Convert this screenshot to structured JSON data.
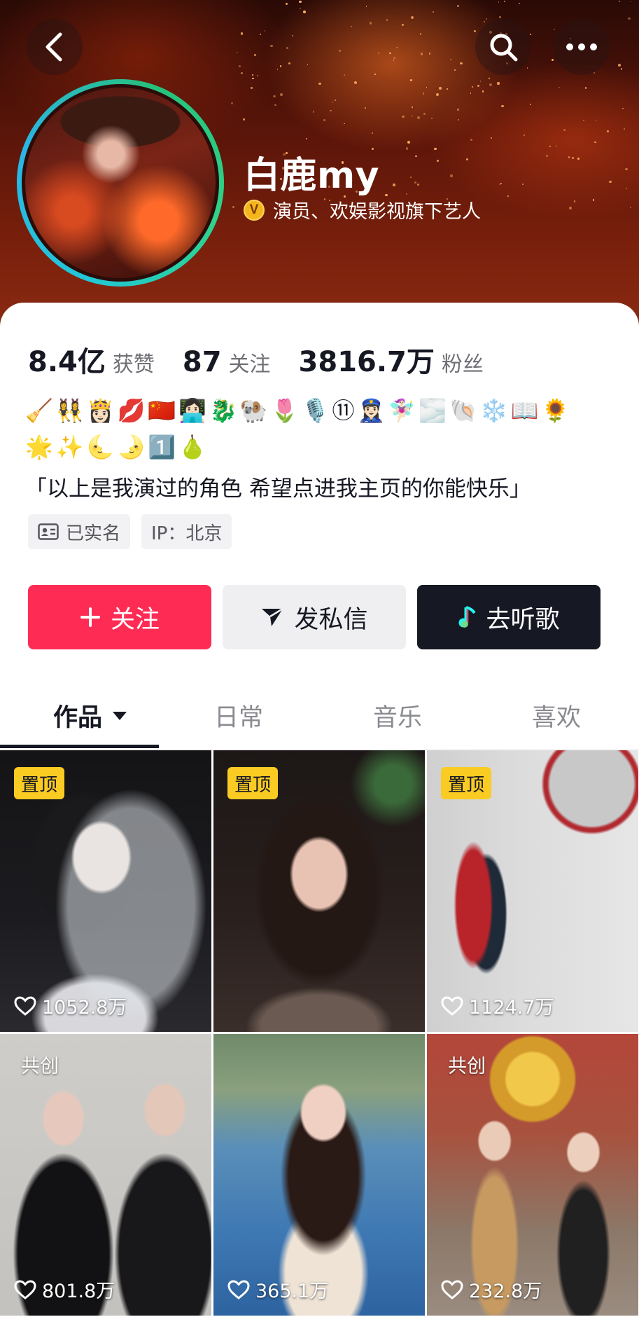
{
  "header": {
    "display_name": "白鹿my",
    "verify_badge": "V",
    "verify_text": "演员、欢娱影视旗下艺人",
    "back_icon": "chevron-left-icon",
    "search_icon": "search-icon",
    "more_icon": "more-dots-icon"
  },
  "stats": [
    {
      "value": "8.4亿",
      "label": "获赞"
    },
    {
      "value": "87",
      "label": "关注"
    },
    {
      "value": "3816.7万",
      "label": "粉丝"
    }
  ],
  "bio": {
    "emoji_line_1": "🧹👯‍♀️👸🏻💋🇨🇳👩🏻‍💻🐉🐏🌷🎙️⑪👮🏻‍♀️🧚🏻‍♀️🌫️🐚❄️📖🌻",
    "emoji_line_2": "🌟✨🌜🌛1️⃣🍐",
    "text": "「以上是我演过的角色 希望点进我主页的你能快乐」"
  },
  "tags": {
    "verified": "已实名",
    "ip": "IP：北京"
  },
  "actions": {
    "follow": "关注",
    "message": "发私信",
    "music": "去听歌"
  },
  "tabs": [
    {
      "label": "作品"
    },
    {
      "label": "日常"
    },
    {
      "label": "音乐"
    },
    {
      "label": "喜欢"
    }
  ],
  "videos": [
    {
      "badge": "置顶",
      "likes": "1052.8万"
    },
    {
      "badge": "置顶",
      "likes": ""
    },
    {
      "badge": "置顶",
      "likes": "1124.7万"
    },
    {
      "badge": "共创",
      "likes": "801.8万"
    },
    {
      "badge": "",
      "likes": "365.1万"
    },
    {
      "badge": "共创",
      "likes": "232.8万"
    }
  ],
  "colors": {
    "follow_button": "#fe2c55",
    "music_button": "#161823",
    "pin_badge": "#facb22",
    "avatar_ring": "#21c7d8"
  }
}
